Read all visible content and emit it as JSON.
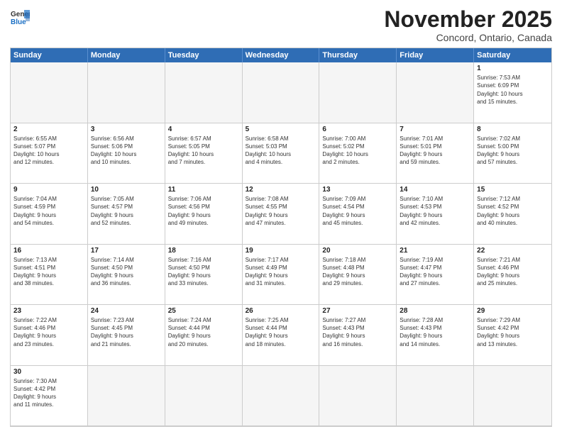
{
  "logo": {
    "line1": "General",
    "line2": "Blue"
  },
  "title": "November 2025",
  "subtitle": "Concord, Ontario, Canada",
  "days": [
    "Sunday",
    "Monday",
    "Tuesday",
    "Wednesday",
    "Thursday",
    "Friday",
    "Saturday"
  ],
  "cells": [
    {
      "date": "",
      "info": "",
      "empty": true
    },
    {
      "date": "",
      "info": "",
      "empty": true
    },
    {
      "date": "",
      "info": "",
      "empty": true
    },
    {
      "date": "",
      "info": "",
      "empty": true
    },
    {
      "date": "",
      "info": "",
      "empty": true
    },
    {
      "date": "",
      "info": "",
      "empty": true
    },
    {
      "date": "1",
      "info": "Sunrise: 7:53 AM\nSunset: 6:09 PM\nDaylight: 10 hours\nand 15 minutes."
    },
    {
      "date": "2",
      "info": "Sunrise: 6:55 AM\nSunset: 5:07 PM\nDaylight: 10 hours\nand 12 minutes."
    },
    {
      "date": "3",
      "info": "Sunrise: 6:56 AM\nSunset: 5:06 PM\nDaylight: 10 hours\nand 10 minutes."
    },
    {
      "date": "4",
      "info": "Sunrise: 6:57 AM\nSunset: 5:05 PM\nDaylight: 10 hours\nand 7 minutes."
    },
    {
      "date": "5",
      "info": "Sunrise: 6:58 AM\nSunset: 5:03 PM\nDaylight: 10 hours\nand 4 minutes."
    },
    {
      "date": "6",
      "info": "Sunrise: 7:00 AM\nSunset: 5:02 PM\nDaylight: 10 hours\nand 2 minutes."
    },
    {
      "date": "7",
      "info": "Sunrise: 7:01 AM\nSunset: 5:01 PM\nDaylight: 9 hours\nand 59 minutes."
    },
    {
      "date": "8",
      "info": "Sunrise: 7:02 AM\nSunset: 5:00 PM\nDaylight: 9 hours\nand 57 minutes."
    },
    {
      "date": "9",
      "info": "Sunrise: 7:04 AM\nSunset: 4:59 PM\nDaylight: 9 hours\nand 54 minutes."
    },
    {
      "date": "10",
      "info": "Sunrise: 7:05 AM\nSunset: 4:57 PM\nDaylight: 9 hours\nand 52 minutes."
    },
    {
      "date": "11",
      "info": "Sunrise: 7:06 AM\nSunset: 4:56 PM\nDaylight: 9 hours\nand 49 minutes."
    },
    {
      "date": "12",
      "info": "Sunrise: 7:08 AM\nSunset: 4:55 PM\nDaylight: 9 hours\nand 47 minutes."
    },
    {
      "date": "13",
      "info": "Sunrise: 7:09 AM\nSunset: 4:54 PM\nDaylight: 9 hours\nand 45 minutes."
    },
    {
      "date": "14",
      "info": "Sunrise: 7:10 AM\nSunset: 4:53 PM\nDaylight: 9 hours\nand 42 minutes."
    },
    {
      "date": "15",
      "info": "Sunrise: 7:12 AM\nSunset: 4:52 PM\nDaylight: 9 hours\nand 40 minutes."
    },
    {
      "date": "16",
      "info": "Sunrise: 7:13 AM\nSunset: 4:51 PM\nDaylight: 9 hours\nand 38 minutes."
    },
    {
      "date": "17",
      "info": "Sunrise: 7:14 AM\nSunset: 4:50 PM\nDaylight: 9 hours\nand 36 minutes."
    },
    {
      "date": "18",
      "info": "Sunrise: 7:16 AM\nSunset: 4:50 PM\nDaylight: 9 hours\nand 33 minutes."
    },
    {
      "date": "19",
      "info": "Sunrise: 7:17 AM\nSunset: 4:49 PM\nDaylight: 9 hours\nand 31 minutes."
    },
    {
      "date": "20",
      "info": "Sunrise: 7:18 AM\nSunset: 4:48 PM\nDaylight: 9 hours\nand 29 minutes."
    },
    {
      "date": "21",
      "info": "Sunrise: 7:19 AM\nSunset: 4:47 PM\nDaylight: 9 hours\nand 27 minutes."
    },
    {
      "date": "22",
      "info": "Sunrise: 7:21 AM\nSunset: 4:46 PM\nDaylight: 9 hours\nand 25 minutes."
    },
    {
      "date": "23",
      "info": "Sunrise: 7:22 AM\nSunset: 4:46 PM\nDaylight: 9 hours\nand 23 minutes."
    },
    {
      "date": "24",
      "info": "Sunrise: 7:23 AM\nSunset: 4:45 PM\nDaylight: 9 hours\nand 21 minutes."
    },
    {
      "date": "25",
      "info": "Sunrise: 7:24 AM\nSunset: 4:44 PM\nDaylight: 9 hours\nand 20 minutes."
    },
    {
      "date": "26",
      "info": "Sunrise: 7:25 AM\nSunset: 4:44 PM\nDaylight: 9 hours\nand 18 minutes."
    },
    {
      "date": "27",
      "info": "Sunrise: 7:27 AM\nSunset: 4:43 PM\nDaylight: 9 hours\nand 16 minutes."
    },
    {
      "date": "28",
      "info": "Sunrise: 7:28 AM\nSunset: 4:43 PM\nDaylight: 9 hours\nand 14 minutes."
    },
    {
      "date": "29",
      "info": "Sunrise: 7:29 AM\nSunset: 4:42 PM\nDaylight: 9 hours\nand 13 minutes."
    },
    {
      "date": "30",
      "info": "Sunrise: 7:30 AM\nSunset: 4:42 PM\nDaylight: 9 hours\nand 11 minutes."
    },
    {
      "date": "",
      "info": "",
      "empty": true
    },
    {
      "date": "",
      "info": "",
      "empty": true
    },
    {
      "date": "",
      "info": "",
      "empty": true
    },
    {
      "date": "",
      "info": "",
      "empty": true
    },
    {
      "date": "",
      "info": "",
      "empty": true
    },
    {
      "date": "",
      "info": "",
      "empty": true
    }
  ]
}
